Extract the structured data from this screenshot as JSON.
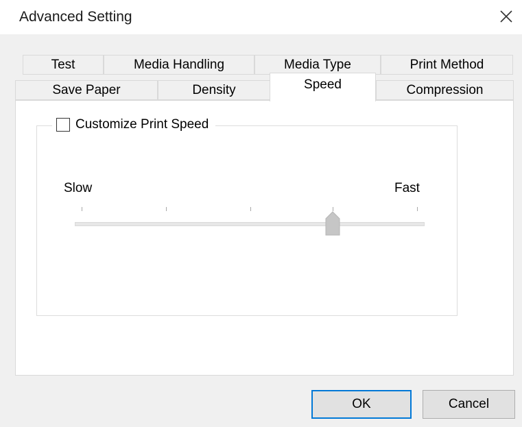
{
  "dialog": {
    "title": "Advanced Setting"
  },
  "tabs": {
    "row_back": [
      "Test",
      "Media Handling",
      "Media Type",
      "Print Method"
    ],
    "row_front": [
      "Save Paper",
      "Density",
      "Speed",
      "Compression"
    ],
    "selected": "Speed"
  },
  "speed_panel": {
    "customize_checkbox": {
      "label": "Customize Print Speed",
      "checked": false
    },
    "slider": {
      "min_label": "Slow",
      "max_label": "Fast",
      "tick_count": 5,
      "position_index": 3
    }
  },
  "buttons": {
    "ok": "OK",
    "cancel": "Cancel"
  },
  "icons": {
    "close": "close-icon",
    "slider_thumb": "slider-thumb-icon"
  }
}
